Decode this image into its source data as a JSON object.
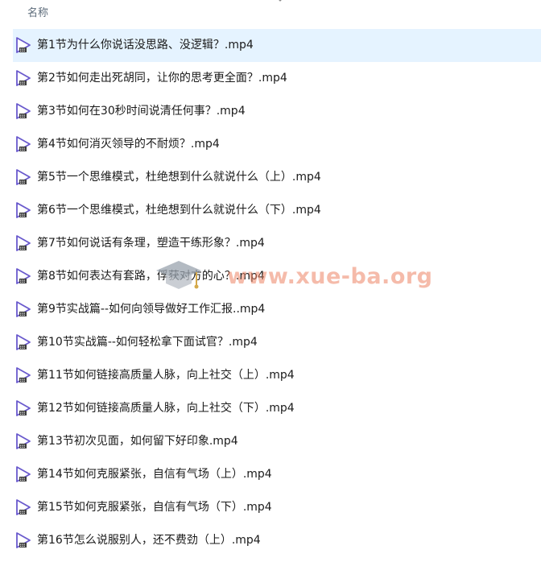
{
  "header": {
    "name_column_label": "名称"
  },
  "files": [
    {
      "name": "第1节为什么你说话没思路、没逻辑？.mp4",
      "selected": true
    },
    {
      "name": "第2节如何走出死胡同，让你的思考更全面？.mp4",
      "selected": false
    },
    {
      "name": "第3节如何在30秒时间说清任何事？.mp4",
      "selected": false
    },
    {
      "name": "第4节如何消灭领导的不耐烦？.mp4",
      "selected": false
    },
    {
      "name": "第5节一个思维模式，杜绝想到什么就说什么（上）.mp4",
      "selected": false
    },
    {
      "name": "第6节一个思维模式，杜绝想到什么就说什么（下）.mp4",
      "selected": false
    },
    {
      "name": "第7节如何说话有条理，塑造干练形象？.mp4",
      "selected": false
    },
    {
      "name": "第8节如何表达有套路，俘获对方的心？.mp4",
      "selected": false
    },
    {
      "name": "第9节实战篇--如何向领导做好工作汇报..mp4",
      "selected": false
    },
    {
      "name": "第10节实战篇--如何轻松拿下面试官？.mp4",
      "selected": false
    },
    {
      "name": "第11节如何链接高质量人脉，向上社交（上）.mp4",
      "selected": false
    },
    {
      "name": "第12节如何链接高质量人脉，向上社交（下）.mp4",
      "selected": false
    },
    {
      "name": "第13节初次见面，如何留下好印象.mp4",
      "selected": false
    },
    {
      "name": "第14节如何克服紧张，自信有气场（上）.mp4",
      "selected": false
    },
    {
      "name": "第15节如何克服紧张，自信有气场（下）.mp4",
      "selected": false
    },
    {
      "name": "第16节怎么说服别人，还不费劲（上）.mp4",
      "selected": false
    }
  ],
  "icons": {
    "file_icon": "video-file-icon",
    "sort_icon": "sort-caret-icon"
  },
  "colors": {
    "selected_row": "#e5f3ff",
    "icon_purple": "#6a5acd",
    "watermark": "#ec8464"
  },
  "watermark": {
    "text": "www.xue-ba.org"
  }
}
